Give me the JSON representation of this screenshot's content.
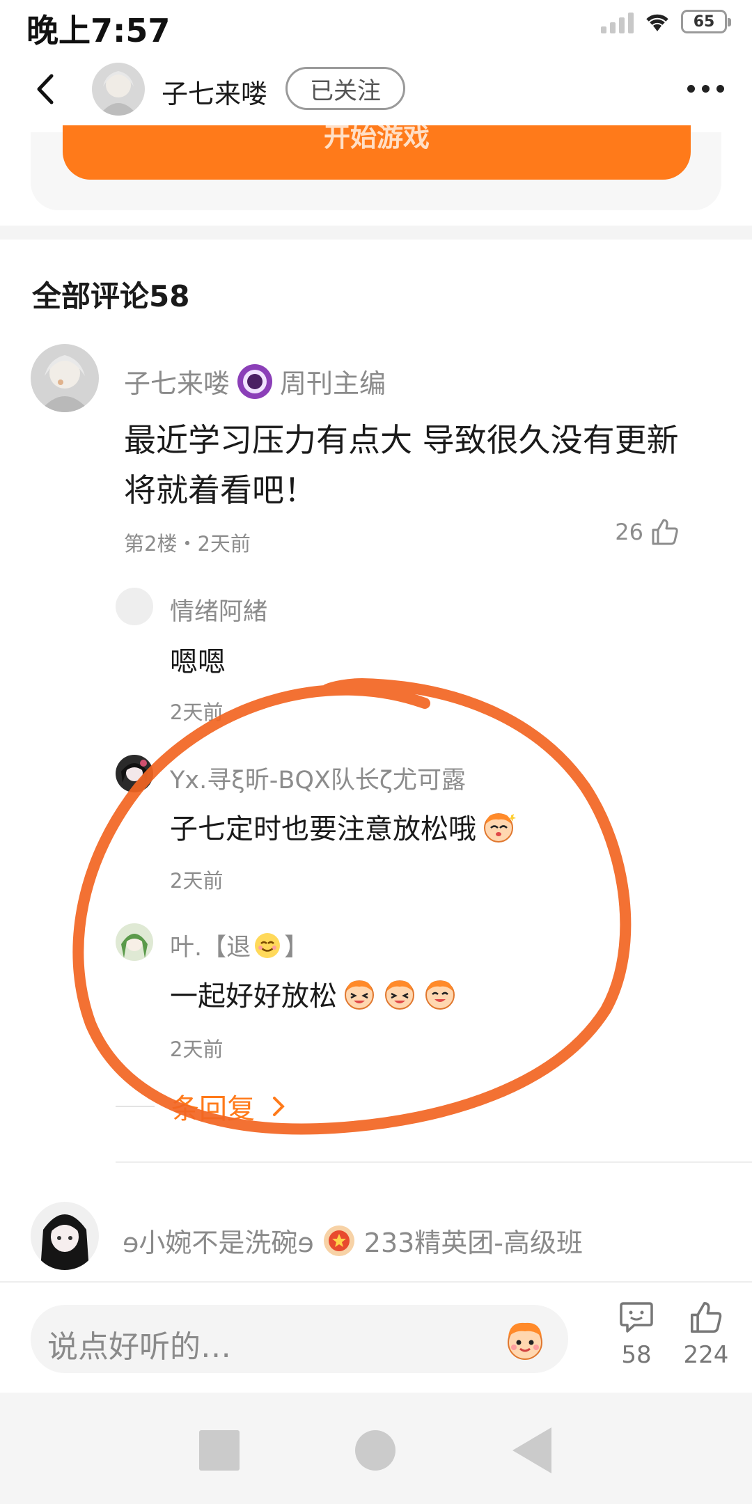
{
  "status_bar": {
    "time": "晚上7:57",
    "battery": "65"
  },
  "nav": {
    "username": "子七来喽",
    "follow_label": "已关注"
  },
  "game_card": {
    "start_label": "开始游戏"
  },
  "comments_section": {
    "title": "全部评论58"
  },
  "comment": {
    "author": "子七来喽",
    "badge": "周刊主编",
    "text": "最近学习压力有点大 导致很久没有更新 将就着看吧！",
    "meta": "第2楼・2天前",
    "likes": "26"
  },
  "replies": [
    {
      "author": "情绪阿緒",
      "text": "嗯嗯",
      "time": "2天前"
    },
    {
      "author": "Yx.寻ξ昕-BQX队长ζ尤可露",
      "text": "子七定时也要注意放松哦",
      "time": "2天前"
    },
    {
      "author": "叶.【退",
      "author_suffix": "】",
      "text": "一起好好放松",
      "time": "2天前"
    }
  ],
  "more_replies_label": "条回复",
  "comment2": {
    "author": "ɘ小婉不是洗碗ɘ",
    "badge": "233精英团-高级班"
  },
  "bottom_bar": {
    "input_placeholder": "说点好听的…",
    "comment_count": "58",
    "like_count": "224"
  },
  "colors": {
    "accent": "#ff7a1a",
    "annotation": "#f26522"
  }
}
